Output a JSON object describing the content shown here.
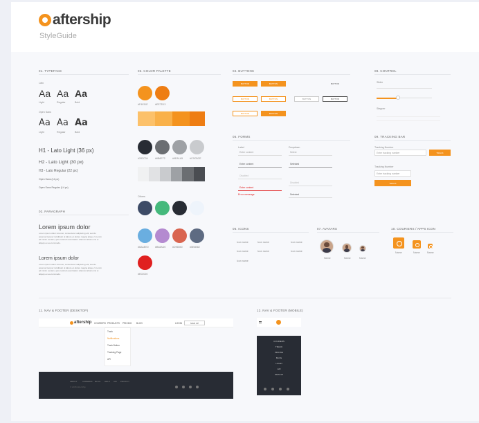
{
  "brand": {
    "name": "aftership",
    "subtitle": "StyleGuide",
    "accent": "#f4931e"
  },
  "sections": {
    "typeface": "01. TYPEFACE",
    "paragraph": "02. PARAGRAPH",
    "color": "03. COLOR PALETTE",
    "buttons": "04. BUTTONS",
    "forms": "05. FORMS",
    "icons": "06. ICONS",
    "avatars": "07. AVATARS",
    "control": "08. CONTROL",
    "tracking": "09. TRACKING BAR",
    "couriers": "10. COURIERS / APPS ICON",
    "nav_desktop": "11. NAV & FOOTER (DESKTOP)",
    "nav_mobile": "12. NAV & FOOTER (MOBILE)"
  },
  "typeface": {
    "lato_label": "Lato",
    "open_sans_label": "Open Sans",
    "sample": "Aa",
    "weights": [
      "Light",
      "Regular",
      "Bold"
    ],
    "h1": "H1 - Lato Light (36 px)",
    "h2": "H2 - Lato Light (30 px)",
    "h3": "H3 - Lato Regular (22 px)",
    "h4": "Open Sans (14 px)",
    "h5": "Open Sans Regular (14 px)"
  },
  "paragraph": {
    "heading1": "Lorem ipsum dolor",
    "heading2": "Lorem ipsum dolor",
    "body": "Lorem ipsum dolor sit amet, consectetur adipiscing elit, sed do eiusmod tempor incididunt ut labore et dolore magna aliqua. Ut enim ad minim veniam, quis nostrud exercitation ullamco laboris nisi ut aliquip ex ea commodo."
  },
  "colors": {
    "orange": [
      "#f4931e",
      "#ee7d13"
    ],
    "orange_labels": [
      "#F4931E",
      "#EE7D13"
    ],
    "orange_strip": [
      "#fcc16a",
      "#f9b14a",
      "#f4931e",
      "#ee7d13"
    ],
    "grays": [
      "#282c34",
      "#6b6e72",
      "#9ea1a5",
      "#c9cbce"
    ],
    "gray_labels": [
      "#282C34",
      "#6B6E72",
      "#9EA1A5",
      "#C9CBCE"
    ],
    "gray_strip": [
      "#f0f1f2",
      "#e1e2e4",
      "#c9cbce",
      "#9ea1a5",
      "#6b6e72",
      "#4a4d52"
    ],
    "accents_label": "Others",
    "accents": [
      "#3d4b66",
      "#45b97c",
      "#282c34",
      "#eef4fb",
      "#6aaee0",
      "#b48ad0",
      "#d96550",
      "#5e6b82"
    ],
    "accent_labels": [
      "#3D4B66",
      "#45B97C",
      "#282C34",
      "#EEF4FB",
      "#6AAEE0",
      "#B48AD0",
      "#D96550",
      "#5E6B82"
    ],
    "red": "#e02020",
    "red_label": "#E02020"
  },
  "buttons": {
    "primary": "BUTTON",
    "secondary": "BUTTON",
    "link": "BUTTON"
  },
  "forms": {
    "label1": "Label",
    "label2": "Dropdown",
    "placeholder": "Enter content",
    "select": "Select",
    "error": "Error message",
    "selected": "Selected",
    "disabled": "Disabled"
  },
  "icons": [
    "Icon name",
    "Icon name",
    "Icon name",
    "Icon name",
    "Icon name",
    "Icon name",
    "Icon name"
  ],
  "avatars": {
    "names": [
      "Name",
      "Name",
      "Name"
    ]
  },
  "control": {
    "slider": "Slider",
    "steps": "Stepper"
  },
  "tracking": {
    "label1": "Tracking Number",
    "placeholder": "Enter tracking number",
    "button": "TRACK",
    "label2": "Tracking Number"
  },
  "couriers": {
    "names": [
      "Name",
      "Name",
      "Name"
    ]
  },
  "nav": {
    "links": [
      "COURIERS",
      "PRODUCTS",
      "PRICING",
      "BLOG"
    ],
    "login": "LOGIN",
    "signup": "SIGN UP",
    "dropdown": [
      "Track",
      "Notifications",
      "Track Button",
      "Tracking Page",
      "API"
    ],
    "footer_links": [
      "ABOUT",
      "CAREERS",
      "BLOG",
      "HELP",
      "API",
      "PRIVACY"
    ],
    "footer_copy": "© 2015 AfterShip"
  },
  "mobile_menu": [
    "COURIERS",
    "TRACK",
    "PRICING",
    "BLOG",
    "LOGIN",
    "API",
    "SIGN UP"
  ]
}
